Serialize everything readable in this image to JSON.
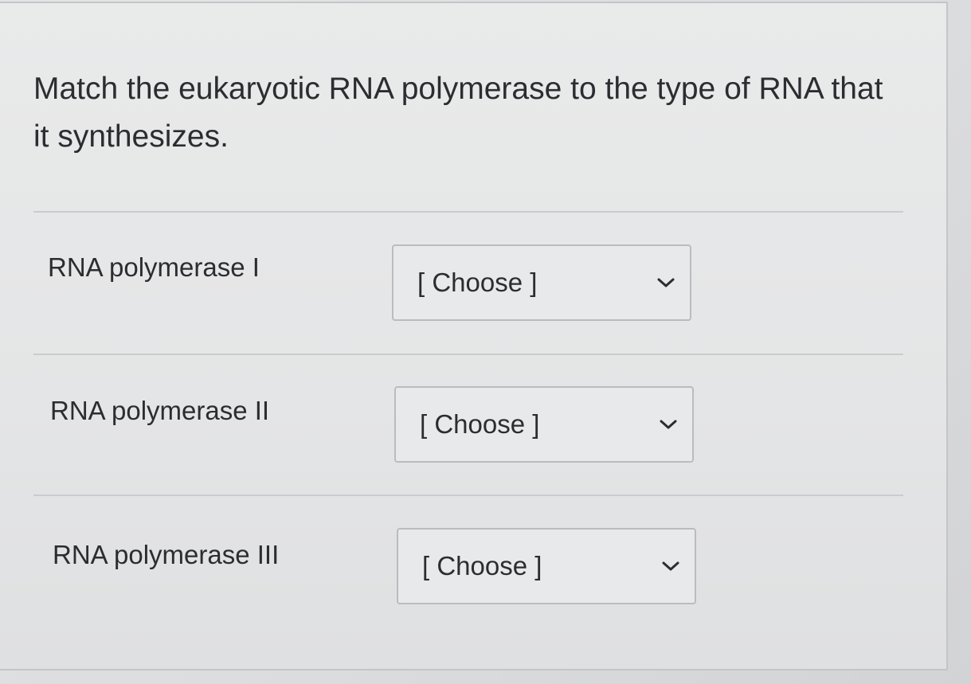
{
  "question": {
    "prompt": "Match the eukaryotic RNA polymerase to the type of RNA that it synthesizes."
  },
  "rows": [
    {
      "label": "RNA polymerase I",
      "selected": "[ Choose ]"
    },
    {
      "label": "RNA polymerase II",
      "selected": "[ Choose ]"
    },
    {
      "label": "RNA polymerase III",
      "selected": "[ Choose ]"
    }
  ],
  "icons": {
    "dropdown": "chevron-down-icon"
  },
  "colors": {
    "text": "#2b2d31",
    "border": "#b9bcc0",
    "divider": "#c9cbce"
  }
}
